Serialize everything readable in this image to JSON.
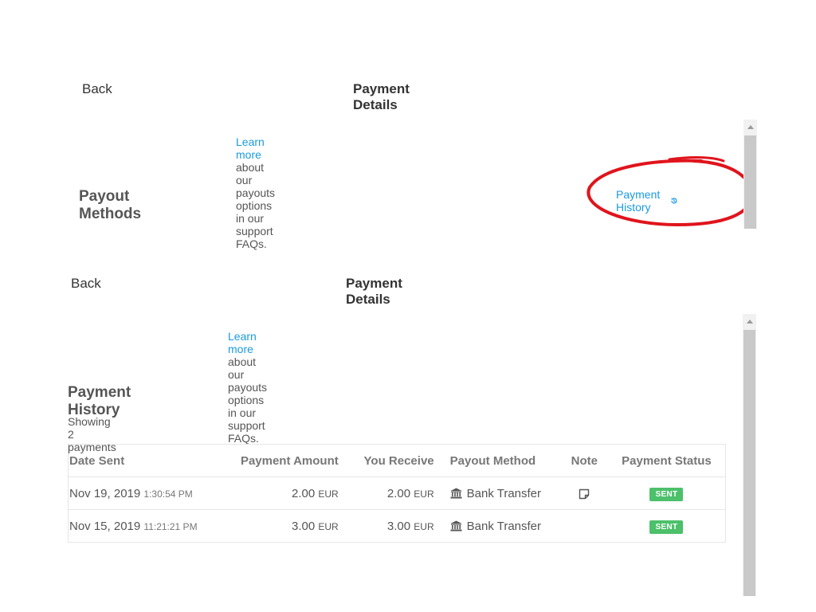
{
  "top": {
    "back_label": "Back",
    "title": "Payment Details",
    "learn_more_link": "Learn more",
    "learn_more_text": " about our payouts options in our support FAQs.",
    "section_title": "Payout Methods",
    "history_link_label": "Payment History",
    "history_icon": "history-icon"
  },
  "bottom": {
    "back_label": "Back",
    "title": "Payment Details",
    "learn_more_link": "Learn more",
    "learn_more_text": " about our payouts options in our support FAQs.",
    "section_title": "Payment History",
    "showing_text": "Showing 2 payments",
    "table": {
      "columns": [
        "Date Sent",
        "Payment Amount",
        "You Receive",
        "Payout Method",
        "Note",
        "Payment Status"
      ],
      "rows": [
        {
          "date": "Nov 19, 2019",
          "time": "1:30:54 PM",
          "amount": "2.00",
          "amount_currency": "EUR",
          "receive": "2.00",
          "receive_currency": "EUR",
          "method_icon": "bank-icon",
          "method": "Bank Transfer",
          "note_icon": "note-icon",
          "status": "SENT"
        },
        {
          "date": "Nov 15, 2019",
          "time": "11:21:21 PM",
          "amount": "3.00",
          "amount_currency": "EUR",
          "receive": "3.00",
          "receive_currency": "EUR",
          "method_icon": "bank-icon",
          "method": "Bank Transfer",
          "note_icon": "",
          "status": "SENT"
        }
      ]
    }
  },
  "colors": {
    "link": "#1a9ae0",
    "sent_badge": "#4cc06a",
    "annotation": "#e0141c"
  }
}
